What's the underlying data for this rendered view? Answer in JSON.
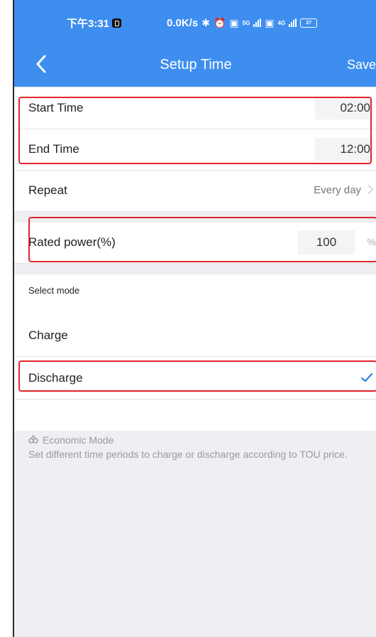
{
  "status_bar": {
    "time": "下午3:31",
    "network_speed": "0.0K/s",
    "net_type_1": "5G",
    "net_type_2": "4G",
    "battery": "27"
  },
  "nav": {
    "title": "Setup Time",
    "save_label": "Save"
  },
  "schedule": {
    "start_label": "Start Time",
    "start_value": "02:00",
    "end_label": "End Time",
    "end_value": "12:00",
    "repeat_label": "Repeat",
    "repeat_value": "Every day"
  },
  "power": {
    "label": "Rated power(%)",
    "value": "100",
    "unit": "%"
  },
  "mode": {
    "section_label": "Select mode",
    "options": [
      {
        "label": "Charge",
        "selected": false
      },
      {
        "label": "Discharge",
        "selected": true
      }
    ]
  },
  "note": {
    "title": "Economic Mode",
    "text": "Set different time periods to charge or discharge according to TOU price."
  },
  "colors": {
    "header": "#3e8ef0",
    "highlight": "#e0252b",
    "check": "#2f80ed"
  }
}
